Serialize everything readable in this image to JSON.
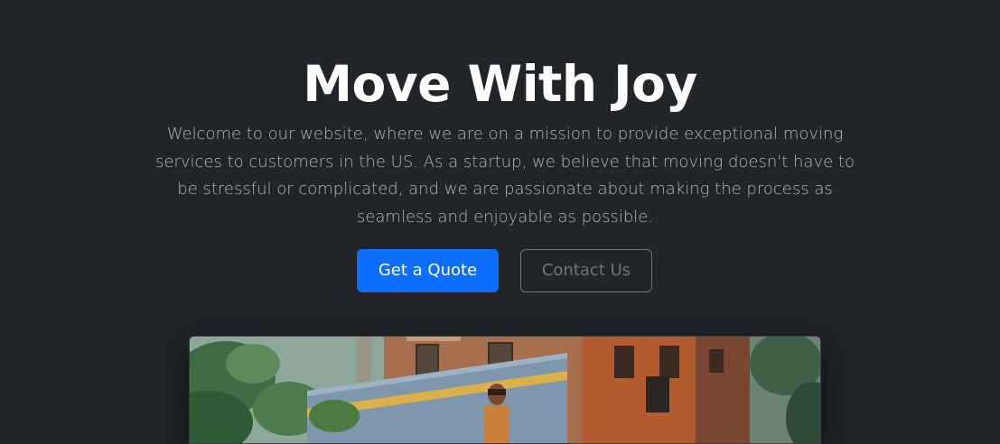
{
  "hero": {
    "title": "Move With Joy",
    "lead": "Welcome to our website, where we are on a mission to provide exceptional moving services to customers in the US. As a startup, we believe that moving doesn't have to be stressful or complicated, and we are passionate about making the process as seamless and enjoyable as possible.",
    "primary_button": "Get a Quote",
    "secondary_button": "Contact Us"
  },
  "colors": {
    "background": "#212529",
    "primary": "#0d6efd",
    "muted": "#6c757d",
    "lead_text": "#adb5bd"
  }
}
